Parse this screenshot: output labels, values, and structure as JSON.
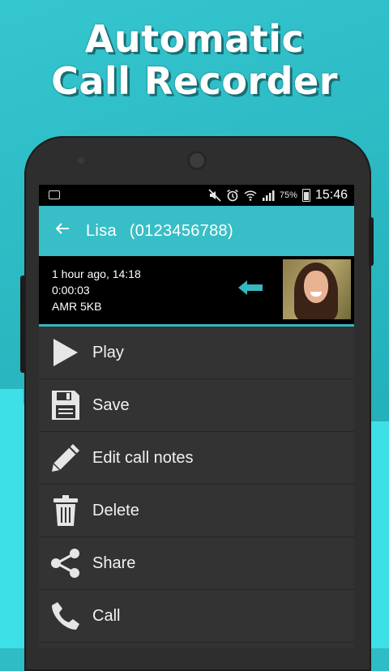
{
  "banner": {
    "line1": "Automatic",
    "line2": "Call Recorder"
  },
  "status_bar": {
    "battery_percent": "75%",
    "time": "15:46",
    "icons": [
      "image-icon",
      "mute-icon",
      "alarm-icon",
      "wifi-icon",
      "signal-icon",
      "battery-icon"
    ]
  },
  "app_bar": {
    "back_icon": "arrow-left-icon",
    "contact_name": "Lisa",
    "contact_number": "(0123456788)"
  },
  "recording": {
    "time_ago": "1 hour ago, 14:18",
    "duration": "0:00:03",
    "format_size": "AMR 5KB",
    "direction_icon": "incoming-arrow-icon",
    "colors": {
      "accent": "#38bec6",
      "arrow": "#37b6be"
    }
  },
  "menu": [
    {
      "label": "Play",
      "icon": "play-icon"
    },
    {
      "label": "Save",
      "icon": "floppy-disk-icon"
    },
    {
      "label": "Edit call notes",
      "icon": "pencil-icon"
    },
    {
      "label": "Delete",
      "icon": "trash-icon"
    },
    {
      "label": "Share",
      "icon": "share-icon"
    },
    {
      "label": "Call",
      "icon": "phone-icon"
    }
  ]
}
